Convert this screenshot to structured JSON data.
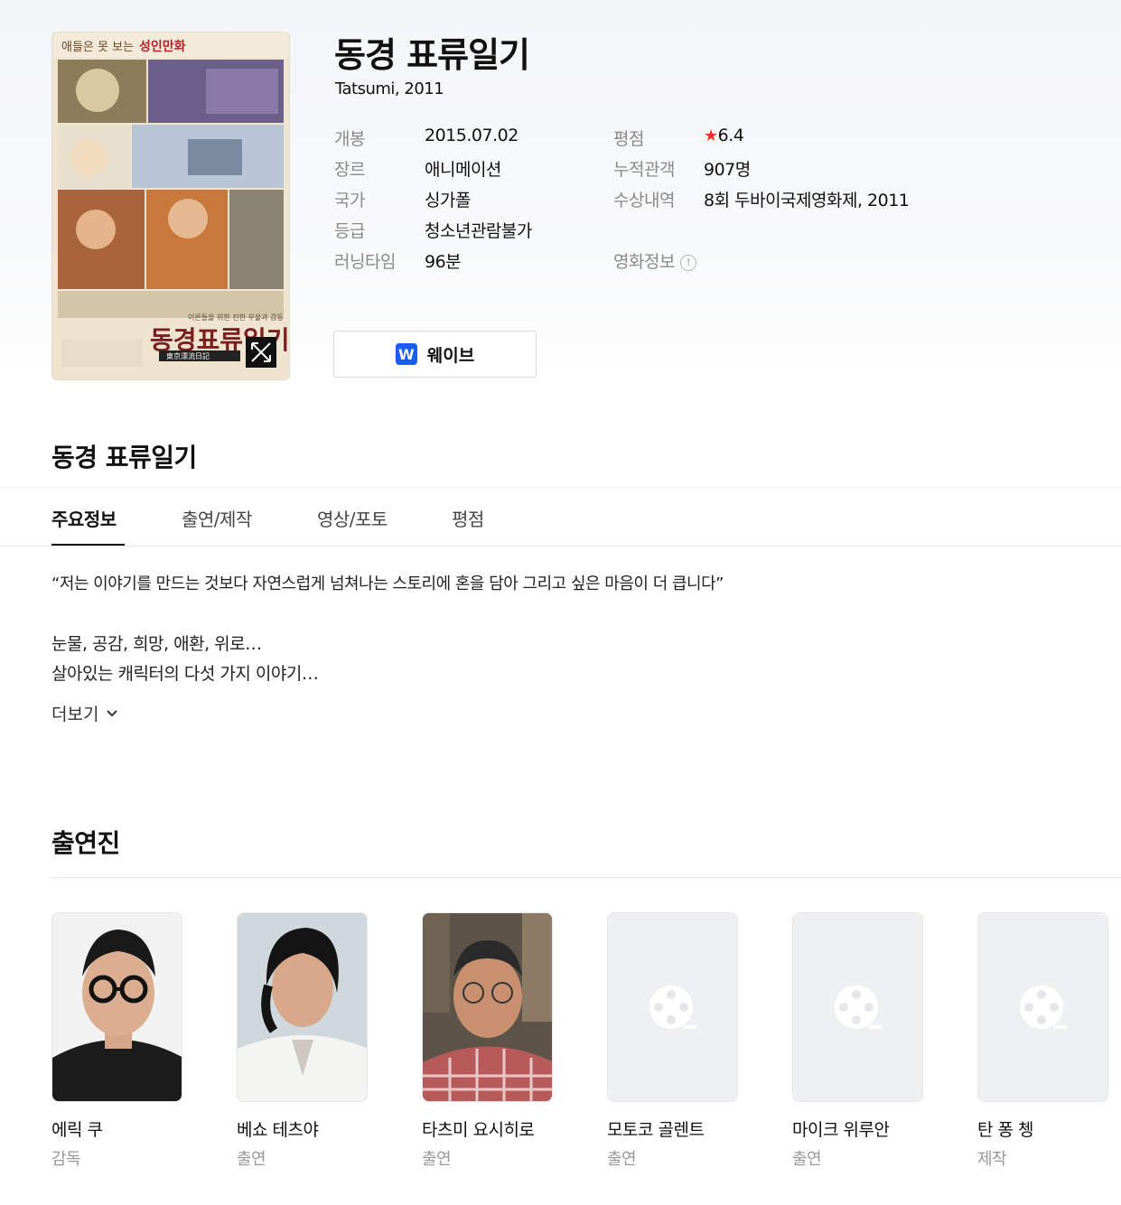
{
  "movie": {
    "title": "동경 표류일기",
    "subtitle": "Tatsumi, 2011",
    "poster": {
      "tagline_prefix": "애들은 못 보는",
      "tagline_highlight": "성인만화",
      "title": "동경표류일기",
      "subtitle_kanji": "東京漂流日記",
      "bottom_text": "이른들을 위한 진한 우울과 감동"
    }
  },
  "info": {
    "release_label": "개봉",
    "release_value": "2015.07.02",
    "genre_label": "장르",
    "genre_value": "애니메이션",
    "country_label": "국가",
    "country_value": "싱가폴",
    "rating_cls_label": "등급",
    "rating_cls_value": "청소년관람불가",
    "runtime_label": "러닝타임",
    "runtime_value": "96분",
    "score_label": "평점",
    "score_star": "★",
    "score_value": "6.4",
    "audience_label": "누적관객",
    "audience_value": "907명",
    "award_label": "수상내역",
    "award_value": "8회 두바이국제영화제, 2011",
    "movieinfo_label": "영화정보",
    "movieinfo_badge": "!"
  },
  "ott": {
    "logo": "W",
    "label": "웨이브"
  },
  "section_title": "동경 표류일기",
  "tabs": [
    {
      "label": "주요정보"
    },
    {
      "label": "출연/제작"
    },
    {
      "label": "영상/포토"
    },
    {
      "label": "평점"
    }
  ],
  "synopsis": {
    "quote": "“저는 이야기를 만드는 것보다 자연스럽게 넘쳐나는 스토리에 혼을 담아 그리고 싶은 마음이 더 큽니다”",
    "line1": "눈물, 공감, 희망, 애환, 위로…",
    "line2": "살아있는 캐릭터의 다섯 가지 이야기…",
    "more_label": "더보기"
  },
  "cast_title": "출연진",
  "cast": [
    {
      "name": "에릭 쿠",
      "role": "감독"
    },
    {
      "name": "베쇼 테츠야",
      "role": "출연"
    },
    {
      "name": "타츠미 요시히로",
      "role": "출연"
    },
    {
      "name": "모토코 골렌트",
      "role": "출연"
    },
    {
      "name": "마이크 위루안",
      "role": "출연"
    },
    {
      "name": "탄 퐁 쳉",
      "role": "제작"
    }
  ],
  "colors": {
    "accent_blue": "#2f6fd6",
    "star_red": "#e8342f",
    "wavve_blue": "#1a5cf0"
  }
}
